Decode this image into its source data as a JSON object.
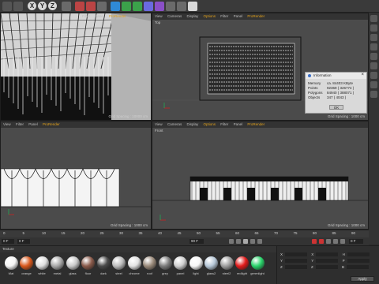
{
  "toolbar": {
    "axis_buttons": [
      "X",
      "Y",
      "Z"
    ]
  },
  "viewports": {
    "perspective": {
      "menu": [
        "Filter",
        "Panel",
        "ProRender"
      ],
      "grid_spacing": "Grid Spacing : 10000 cm"
    },
    "top": {
      "menu": [
        "View",
        "Cameras",
        "Display",
        "Options",
        "Filter",
        "Panel",
        "ProRender"
      ],
      "label": "Top",
      "grid_spacing": "Grid Spacing : 1000 cm"
    },
    "right": {
      "menu": [
        "View",
        "Filter",
        "Panel",
        "ProRender"
      ],
      "grid_spacing": "Grid Spacing : 1000 cm"
    },
    "front": {
      "menu": [
        "View",
        "Cameras",
        "Display",
        "Options",
        "Filter",
        "Panel",
        "ProRender"
      ],
      "label": "Front",
      "grid_spacing": "Grid Spacing : 1000 cm"
    }
  },
  "info_dialog": {
    "title": "Information",
    "rows": [
      {
        "label": "Memory",
        "value": "ca. 84403 KByte"
      },
      {
        "label": "Points",
        "value": "92369 ( 326774 )"
      },
      {
        "label": "Polygons",
        "value": "84940 ( 388071 )"
      },
      {
        "label": "Objects",
        "value": "347 ( 4043 )"
      }
    ],
    "ok_label": "OK"
  },
  "timeline": {
    "ticks": [
      "0",
      "5",
      "10",
      "15",
      "20",
      "25",
      "30",
      "35",
      "40",
      "45",
      "50",
      "55",
      "60",
      "65",
      "70",
      "75",
      "80",
      "85",
      "90"
    ],
    "current_frame": "0 F",
    "start_frame": "0 F",
    "end_frame": "90 F",
    "end_display": "0 F"
  },
  "materials": {
    "menu": [
      "Create",
      "Edit",
      "Function",
      "Texture"
    ],
    "visible_menu_label": "Texture",
    "items": [
      {
        "name": "Mat",
        "color": "#f5f5f5"
      },
      {
        "name": "orange",
        "color": "#d9581c"
      },
      {
        "name": "white",
        "color": "#dedede"
      },
      {
        "name": "metal",
        "color": "#a9a9a9"
      },
      {
        "name": "glass",
        "color": "#c9c9c9"
      },
      {
        "name": "floor",
        "color": "#8a5a4a"
      },
      {
        "name": "dark",
        "color": "#4a4a4a"
      },
      {
        "name": "steel",
        "color": "#bdbdbd"
      },
      {
        "name": "chrome",
        "color": "#e2e2e2"
      },
      {
        "name": "roof",
        "color": "#9a8a7a"
      },
      {
        "name": "grey",
        "color": "#7c7c7c"
      },
      {
        "name": "panel",
        "color": "#d0d0d0"
      },
      {
        "name": "light",
        "color": "#f7f7f7"
      },
      {
        "name": "glass2",
        "color": "#b7c8d8"
      },
      {
        "name": "steel2",
        "color": "#9f9f9f"
      },
      {
        "name": "redlight",
        "color": "#e31b1b"
      },
      {
        "name": "greenlight",
        "color": "#29d36a"
      }
    ]
  },
  "attributes": {
    "rows": [
      {
        "a": "X",
        "b": "X",
        "c": "H"
      },
      {
        "a": "Y",
        "b": "Y",
        "c": "P"
      },
      {
        "a": "Z",
        "b": "Z",
        "c": "B"
      }
    ],
    "apply_label": "Apply"
  },
  "colors": {
    "menu_highlight": "#e3a21a",
    "viewport_bg": "#4b4b4b"
  }
}
